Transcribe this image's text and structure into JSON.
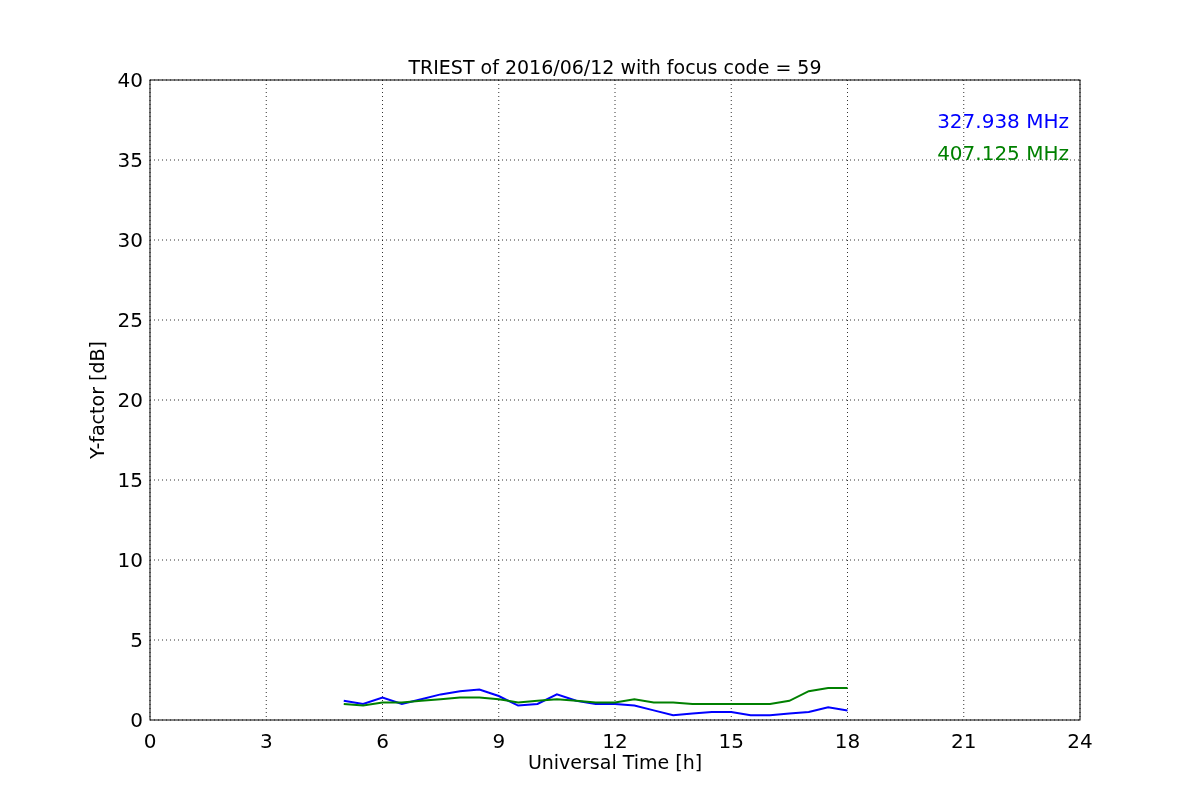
{
  "figure": {
    "chart_data": {
      "type": "line",
      "title": "TRIEST of 2016/06/12 with focus code = 59",
      "xlabel": "Universal Time [h]",
      "ylabel": "Y-factor [dB]",
      "x": [
        5,
        5.5,
        6,
        6.5,
        7,
        7.5,
        8,
        8.5,
        9,
        9.5,
        10,
        10.5,
        11,
        11.5,
        12,
        12.5,
        13,
        13.5,
        14,
        14.5,
        15,
        15.5,
        16,
        16.5,
        17,
        17.5,
        18
      ],
      "series": [
        {
          "name": "327.938 MHz",
          "color": "#0000ff",
          "values": [
            1.2,
            1.0,
            1.4,
            1.0,
            1.3,
            1.6,
            1.8,
            1.9,
            1.5,
            0.9,
            1.0,
            1.6,
            1.2,
            1.0,
            1.0,
            0.9,
            0.6,
            0.3,
            0.4,
            0.5,
            0.5,
            0.3,
            0.3,
            0.4,
            0.5,
            0.8,
            0.6
          ]
        },
        {
          "name": "407.125 MHz",
          "color": "#008000",
          "values": [
            1.0,
            0.9,
            1.1,
            1.1,
            1.2,
            1.3,
            1.4,
            1.4,
            1.3,
            1.1,
            1.2,
            1.3,
            1.2,
            1.1,
            1.1,
            1.3,
            1.1,
            1.1,
            1.0,
            1.0,
            1.0,
            1.0,
            1.0,
            1.2,
            1.8,
            2.0,
            2.0
          ]
        }
      ],
      "xlim": [
        0,
        24
      ],
      "ylim": [
        0,
        40
      ],
      "xticks": [
        0,
        3,
        6,
        9,
        12,
        15,
        18,
        21,
        24
      ],
      "yticks": [
        0,
        5,
        10,
        15,
        20,
        25,
        30,
        35,
        40
      ],
      "grid": true
    }
  }
}
